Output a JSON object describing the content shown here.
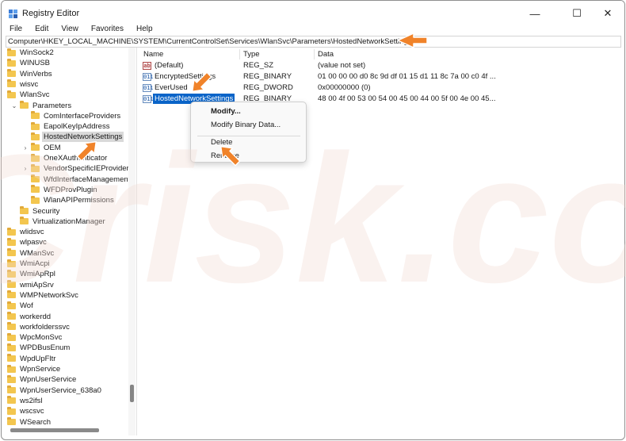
{
  "window": {
    "title": "Registry Editor"
  },
  "window_controls": {
    "minimize": "—",
    "maximize": "☐",
    "close": "✕"
  },
  "menu": [
    "File",
    "Edit",
    "View",
    "Favorites",
    "Help"
  ],
  "address": "Computer\\HKEY_LOCAL_MACHINE\\SYSTEM\\CurrentControlSet\\Services\\WlanSvc\\Parameters\\HostedNetworkSettings",
  "tree": [
    {
      "label": "WinSock2",
      "level": 0,
      "chevron": ""
    },
    {
      "label": "WINUSB",
      "level": 0,
      "chevron": ""
    },
    {
      "label": "WinVerbs",
      "level": 0,
      "chevron": ""
    },
    {
      "label": "wisvc",
      "level": 0,
      "chevron": ""
    },
    {
      "label": "WlanSvc",
      "level": 0,
      "chevron": ""
    },
    {
      "label": "Parameters",
      "level": 1,
      "chevron": "⌄"
    },
    {
      "label": "ComInterfaceProviders",
      "level": 2,
      "chevron": ""
    },
    {
      "label": "EapolKeyIpAddress",
      "level": 2,
      "chevron": ""
    },
    {
      "label": "HostedNetworkSettings",
      "level": 2,
      "chevron": "",
      "selected": true
    },
    {
      "label": "OEM",
      "level": 2,
      "chevron": "›"
    },
    {
      "label": "OneXAuthenticator",
      "level": 2,
      "chevron": ""
    },
    {
      "label": "VendorSpecificIEProviders",
      "level": 2,
      "chevron": "›"
    },
    {
      "label": "WfdInterfaceManagement",
      "level": 2,
      "chevron": ""
    },
    {
      "label": "WFDProvPlugin",
      "level": 2,
      "chevron": ""
    },
    {
      "label": "WlanAPIPermissions",
      "level": 2,
      "chevron": ""
    },
    {
      "label": "Security",
      "level": 1,
      "chevron": ""
    },
    {
      "label": "VirtualizationManager",
      "level": 1,
      "chevron": ""
    },
    {
      "label": "wlidsvc",
      "level": 0,
      "chevron": ""
    },
    {
      "label": "wlpasvc",
      "level": 0,
      "chevron": ""
    },
    {
      "label": "WManSvc",
      "level": 0,
      "chevron": ""
    },
    {
      "label": "WmiAcpi",
      "level": 0,
      "chevron": ""
    },
    {
      "label": "WmiApRpl",
      "level": 0,
      "chevron": ""
    },
    {
      "label": "wmiApSrv",
      "level": 0,
      "chevron": ""
    },
    {
      "label": "WMPNetworkSvc",
      "level": 0,
      "chevron": ""
    },
    {
      "label": "Wof",
      "level": 0,
      "chevron": ""
    },
    {
      "label": "workerdd",
      "level": 0,
      "chevron": ""
    },
    {
      "label": "workfolderssvc",
      "level": 0,
      "chevron": ""
    },
    {
      "label": "WpcMonSvc",
      "level": 0,
      "chevron": ""
    },
    {
      "label": "WPDBusEnum",
      "level": 0,
      "chevron": ""
    },
    {
      "label": "WpdUpFltr",
      "level": 0,
      "chevron": ""
    },
    {
      "label": "WpnService",
      "level": 0,
      "chevron": ""
    },
    {
      "label": "WpnUserService",
      "level": 0,
      "chevron": ""
    },
    {
      "label": "WpnUserService_638a0",
      "level": 0,
      "chevron": ""
    },
    {
      "label": "ws2ifsl",
      "level": 0,
      "chevron": ""
    },
    {
      "label": "wscsvc",
      "level": 0,
      "chevron": ""
    },
    {
      "label": "WSearch",
      "level": 0,
      "chevron": ""
    }
  ],
  "values": {
    "headers": {
      "name": "Name",
      "type": "Type",
      "data": "Data"
    },
    "rows": [
      {
        "icon": "ab",
        "icon_kind": "string",
        "name": "(Default)",
        "type": "REG_SZ",
        "data": "(value not set)"
      },
      {
        "icon": "011",
        "icon_kind": "binary",
        "name": "EncryptedSettings",
        "type": "REG_BINARY",
        "data": "01 00 00 00 d0 8c 9d df 01 15 d1 11 8c 7a 00 c0 4f ..."
      },
      {
        "icon": "011",
        "icon_kind": "binary",
        "name": "EverUsed",
        "type": "REG_DWORD",
        "data": "0x00000000 (0)"
      },
      {
        "icon": "011",
        "icon_kind": "binary",
        "name": "HostedNetworkSettings",
        "type": "REG_BINARY",
        "data": "48 00 4f 00 53 00 54 00 45 00 44 00 5f 00 4e 00 45...",
        "selected": true
      }
    ]
  },
  "context_menu": {
    "modify": "Modify...",
    "modify_binary": "Modify Binary Data...",
    "delete": "Delete",
    "rename": "Rename"
  },
  "colors": {
    "selection": "#0a64c8",
    "tree_selection": "#d9d9d9",
    "folder": "#f3c64f",
    "arrow": "#f0832a"
  },
  "watermark_text": "PCrisk.com"
}
